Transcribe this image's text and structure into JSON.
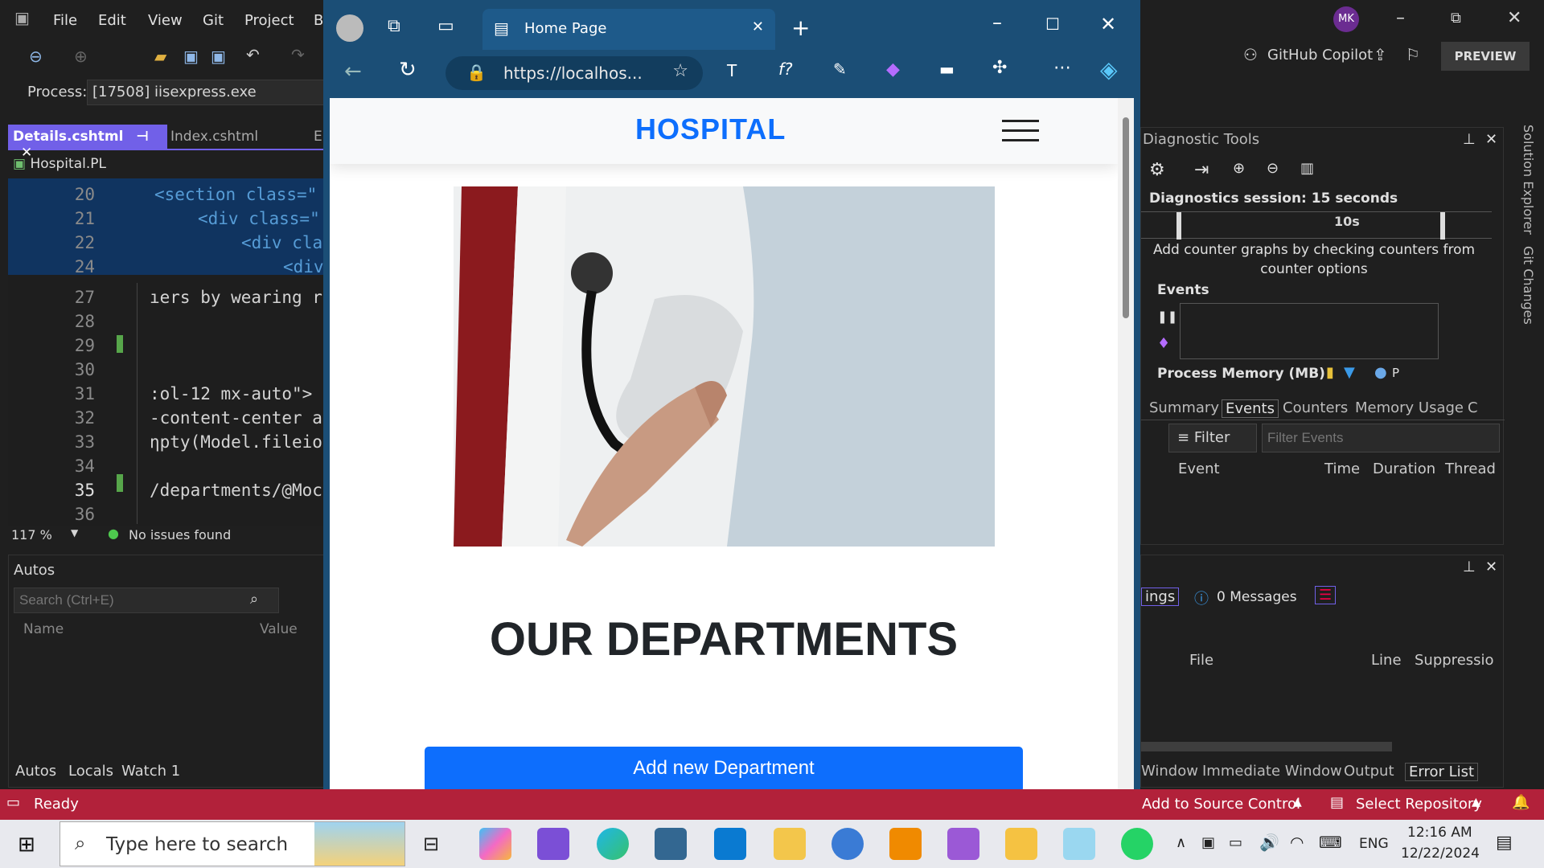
{
  "vs": {
    "menu": [
      "File",
      "Edit",
      "View",
      "Git",
      "Project",
      "B"
    ],
    "process_label": "Process:",
    "process_value": "[17508] iisexpress.exe",
    "tabs": {
      "active": "Details.cshtml",
      "second": "Index.cshtml",
      "third": "E"
    },
    "project": "Hospital.PL",
    "lines": [
      {
        "n": "20",
        "code": "<section class=\""
      },
      {
        "n": "21",
        "code": "<div class=\""
      },
      {
        "n": "22",
        "code": "<div cla"
      },
      {
        "n": "24",
        "code": "<div"
      },
      {
        "n": "27",
        "code": "ıers by wearing r"
      },
      {
        "n": "28",
        "code": ""
      },
      {
        "n": "29",
        "code": ""
      },
      {
        "n": "30",
        "code": ""
      },
      {
        "n": "31",
        "code": ":ol-12 mx-auto\">"
      },
      {
        "n": "32",
        "code": "-content-center a"
      },
      {
        "n": "33",
        "code": "ηpty(Model.fileio"
      },
      {
        "n": "34",
        "code": ""
      },
      {
        "n": "35",
        "code": "/departments/@Moc"
      },
      {
        "n": "36",
        "code": ""
      }
    ],
    "zoom": "117 %",
    "issues": "No issues found",
    "autos": {
      "title": "Autos",
      "search_placeholder": "Search (Ctrl+E)",
      "col_name": "Name",
      "col_value": "Value"
    },
    "bottom_tabs": [
      "Autos",
      "Locals",
      "Watch 1"
    ],
    "status": "Ready"
  },
  "browser": {
    "tab_title": "Home Page",
    "url": "https://localhos...",
    "page": {
      "brand": "HOSPITAL",
      "heading": "OUR DEPARTMENTS",
      "button": "Add new Department"
    }
  },
  "right": {
    "user": "MK",
    "copilot": "GitHub Copilot",
    "preview": "PREVIEW",
    "diag_title": "Diagnostic Tools",
    "session": "Diagnostics session: 15 seconds",
    "timeline": "10s",
    "counter_hint": "Add counter graphs by checking counters from counter options",
    "events": "Events",
    "process_memory": "Process Memory (MB)",
    "memory_legend": "P",
    "tabs": [
      "Summary",
      "Events",
      "Counters",
      "Memory Usage",
      "C"
    ],
    "filter": "Filter",
    "filter_placeholder": "Filter Events",
    "cols": [
      "Event",
      "Time",
      "Duration",
      "Thread"
    ],
    "errors": {
      "warnings": "ings",
      "messages": "0 Messages",
      "cols": [
        "File",
        "Line",
        "Suppressio"
      ]
    },
    "bottom_tabs": [
      "Window",
      "Immediate Window",
      "Output",
      "Error List"
    ],
    "side": [
      "Solution Explorer",
      "Git Changes"
    ],
    "source": "Add to Source Control",
    "repo": "Select Repository"
  },
  "taskbar": {
    "search": "Type here to search",
    "lang": "ENG",
    "time": "12:16 AM",
    "date": "12/22/2024"
  }
}
